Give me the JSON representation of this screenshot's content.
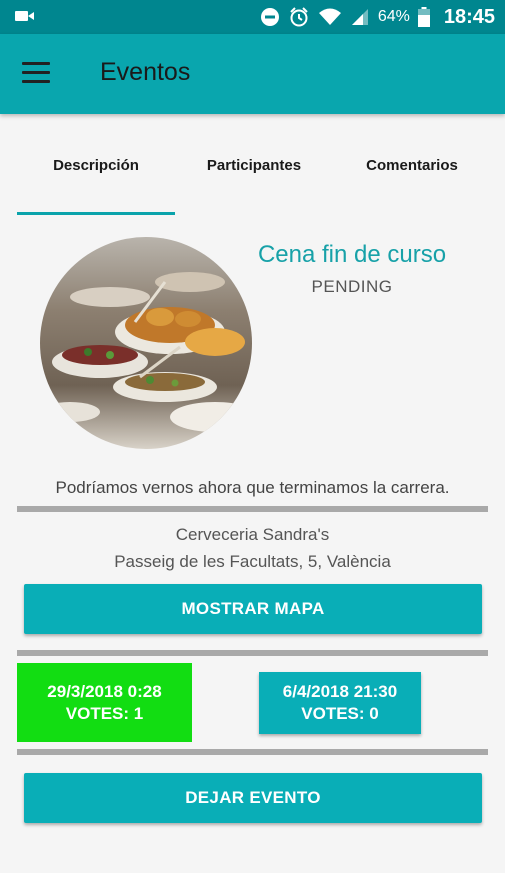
{
  "status_bar": {
    "battery_percent": "64%",
    "time": "18:45",
    "icons": [
      "camera-icon",
      "do-not-disturb-icon",
      "alarm-icon",
      "wifi-icon",
      "cell-signal-icon",
      "battery-icon"
    ]
  },
  "app_bar": {
    "title": "Eventos",
    "menu_icon": "hamburger-menu-icon"
  },
  "tabs": [
    {
      "label": "Descripción",
      "selected": true
    },
    {
      "label": "Participantes",
      "selected": false
    },
    {
      "label": "Comentarios",
      "selected": false
    }
  ],
  "event": {
    "title": "Cena fin de curso",
    "status": "PENDING",
    "description": "Podríamos vernos ahora que terminamos la carrera.",
    "location_name": "Cerveceria Sandra's",
    "location_address": "Passeig de les Facultats, 5, València"
  },
  "buttons": {
    "show_map": "MOSTRAR MAPA",
    "leave_event": "DEJAR EVENTO"
  },
  "date_options": [
    {
      "date": "29/3/2018 0:28",
      "votes": "VOTES: 1",
      "selected": true,
      "color": "#12dd12"
    },
    {
      "date": "6/4/2018 21:30",
      "votes": "VOTES: 0",
      "selected": false,
      "color": "#09aeb7"
    }
  ],
  "colors": {
    "status_bar": "#00868f",
    "app_bar": "#09a6ae",
    "accent": "#09aeb7",
    "title_text": "#17a1a8",
    "selected_date": "#12dd12"
  }
}
